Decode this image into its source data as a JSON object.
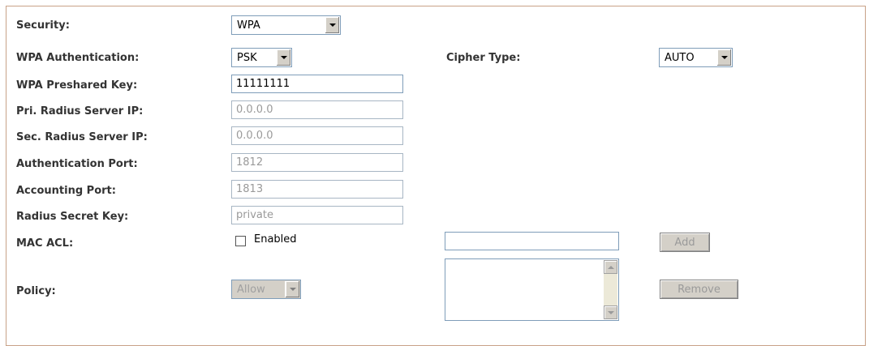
{
  "fields": {
    "security": {
      "label": "Security:",
      "value": "WPA"
    },
    "wpa_auth": {
      "label": "WPA Authentication:",
      "value": "PSK"
    },
    "cipher": {
      "label": "Cipher Type:",
      "value": "AUTO"
    },
    "preshared": {
      "label": "WPA Preshared Key:",
      "value": "11111111"
    },
    "pri_radius": {
      "label": "Pri. Radius Server IP:",
      "value": "0.0.0.0"
    },
    "sec_radius": {
      "label": "Sec. Radius Server IP:",
      "value": "0.0.0.0"
    },
    "auth_port": {
      "label": "Authentication Port:",
      "value": "1812"
    },
    "acct_port": {
      "label": "Accounting Port:",
      "value": "1813"
    },
    "radius_key": {
      "label": "Radius Secret Key:",
      "value": "private"
    },
    "mac_acl": {
      "label": "MAC ACL:",
      "checkbox_label": "Enabled",
      "checked": false,
      "input_value": ""
    },
    "policy": {
      "label": "Policy:",
      "value": "Allow"
    }
  },
  "buttons": {
    "add": "Add",
    "remove": "Remove"
  }
}
